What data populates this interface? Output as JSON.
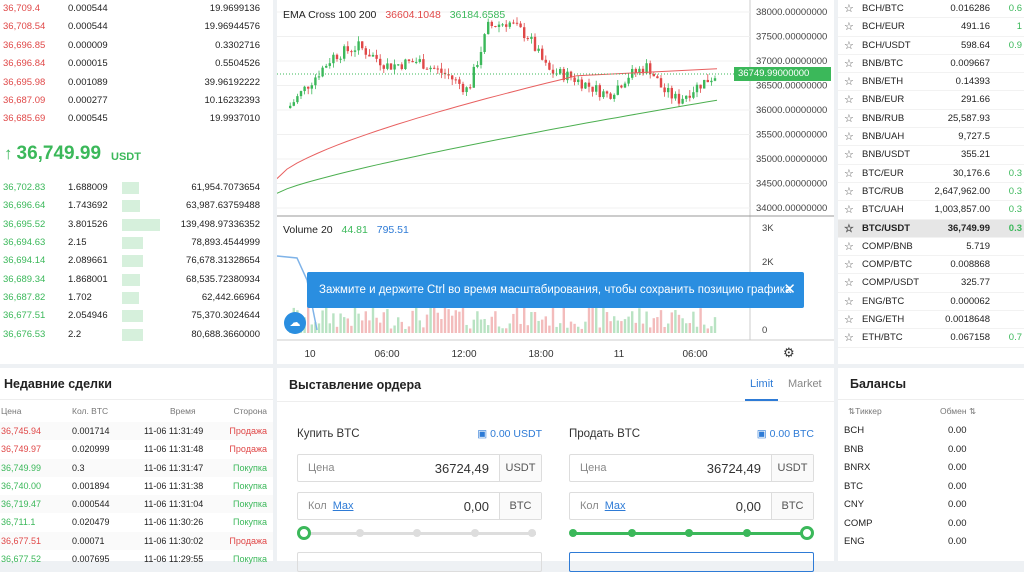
{
  "orderbook": {
    "asks": [
      {
        "p": "36,709.4",
        "a": "0.000544",
        "t": "19.9699136"
      },
      {
        "p": "36,708.54",
        "a": "0.000544",
        "t": "19.96944576"
      },
      {
        "p": "36,696.85",
        "a": "0.000009",
        "t": "0.3302716"
      },
      {
        "p": "36,696.84",
        "a": "0.000015",
        "t": "0.5504526"
      },
      {
        "p": "36,695.98",
        "a": "0.001089",
        "t": "39.96192222"
      },
      {
        "p": "36,687.09",
        "a": "0.000277",
        "t": "10.16232393"
      },
      {
        "p": "36,685.69",
        "a": "0.000545",
        "t": "19.9937010"
      }
    ],
    "last_price": "36,749.99",
    "last_unit": "USDT",
    "bids": [
      {
        "p": "36,702.83",
        "a": "1.688009",
        "t": "61,954.7073654",
        "f": 0.12
      },
      {
        "p": "36,696.64",
        "a": "1.743692",
        "t": "63,987.63759488",
        "f": 0.13
      },
      {
        "p": "36,695.52",
        "a": "3.801526",
        "t": "139,498.97336352",
        "f": 0.27
      },
      {
        "p": "36,694.63",
        "a": "2.15",
        "t": "78,893.4544999",
        "f": 0.15
      },
      {
        "p": "36,694.14",
        "a": "2.089661",
        "t": "76,678.31328654",
        "f": 0.15
      },
      {
        "p": "36,689.34",
        "a": "1.868001",
        "t": "68,535.72380934",
        "f": 0.13
      },
      {
        "p": "36,687.82",
        "a": "1.702",
        "t": "62,442.66964",
        "f": 0.12
      },
      {
        "p": "36,677.51",
        "a": "2.054946",
        "t": "75,370.3024644",
        "f": 0.15
      },
      {
        "p": "36,676.53",
        "a": "2.2",
        "t": "80,688.3660000",
        "f": 0.15
      }
    ]
  },
  "chart": {
    "ema_label": "EMA Cross 100 200",
    "ema1": "36604.1048",
    "ema2": "36184.6585",
    "volume_label": "Volume 20",
    "vol1": "44.81",
    "vol2": "795.51",
    "price_ticks": [
      "38000.00000000",
      "37500.00000000",
      "37000.00000000",
      "36500.00000000",
      "36000.00000000",
      "35500.00000000",
      "35000.00000000",
      "34500.00000000",
      "34000.00000000"
    ],
    "current_price": "36749.99000000",
    "vol_ticks": [
      "3K",
      "2K",
      "1K",
      "0"
    ],
    "time_ticks": [
      "10",
      "06:00",
      "12:00",
      "18:00",
      "11",
      "06:00"
    ],
    "colors": {
      "up": "#3bb85a",
      "down": "#e04848",
      "ema_fast": "#e86060",
      "ema_slow": "#4caf50"
    }
  },
  "tooltip": {
    "text": "Зажмите и держите Ctrl во время масштабирования, чтобы сохранить позицию графика",
    "close": "✕"
  },
  "pairs": [
    {
      "n": "BCH/BTC",
      "p": "0.016286",
      "c": "0.6"
    },
    {
      "n": "BCH/EUR",
      "p": "491.16",
      "c": "1"
    },
    {
      "n": "BCH/USDT",
      "p": "598.64",
      "c": "0.9"
    },
    {
      "n": "BNB/BTC",
      "p": "0.009667",
      "c": ""
    },
    {
      "n": "BNB/ETH",
      "p": "0.14393",
      "c": ""
    },
    {
      "n": "BNB/EUR",
      "p": "291.66",
      "c": ""
    },
    {
      "n": "BNB/RUB",
      "p": "25,587.93",
      "c": ""
    },
    {
      "n": "BNB/UAH",
      "p": "9,727.5",
      "c": ""
    },
    {
      "n": "BNB/USDT",
      "p": "355.21",
      "c": ""
    },
    {
      "n": "BTC/EUR",
      "p": "30,176.6",
      "c": "0.3"
    },
    {
      "n": "BTC/RUB",
      "p": "2,647,962.00",
      "c": "0.3"
    },
    {
      "n": "BTC/UAH",
      "p": "1,003,857.00",
      "c": "0.3"
    },
    {
      "n": "BTC/USDT",
      "p": "36,749.99",
      "c": "0.3",
      "sel": true
    },
    {
      "n": "COMP/BNB",
      "p": "5.719",
      "c": ""
    },
    {
      "n": "COMP/BTC",
      "p": "0.008868",
      "c": ""
    },
    {
      "n": "COMP/USDT",
      "p": "325.77",
      "c": ""
    },
    {
      "n": "ENG/BTC",
      "p": "0.000062",
      "c": ""
    },
    {
      "n": "ENG/ETH",
      "p": "0.0018648",
      "c": ""
    },
    {
      "n": "ETH/BTC",
      "p": "0.067158",
      "c": "0.7"
    }
  ],
  "trades": {
    "title": "Недавние сделки",
    "headers": [
      "Цена",
      "Кол. BTC",
      "Время",
      "Сторона"
    ],
    "rows": [
      {
        "p": "36,745.94",
        "a": "0.001714",
        "t": "11-06 11:31:49",
        "s": "Продажа",
        "side": "sell"
      },
      {
        "p": "36,749.97",
        "a": "0.020999",
        "t": "11-06 11:31:48",
        "s": "Продажа",
        "side": "sell"
      },
      {
        "p": "36,749.99",
        "a": "0.3",
        "t": "11-06 11:31:47",
        "s": "Покупка",
        "side": "buy"
      },
      {
        "p": "36,740.00",
        "a": "0.001894",
        "t": "11-06 11:31:38",
        "s": "Покупка",
        "side": "buy"
      },
      {
        "p": "36,719.47",
        "a": "0.000544",
        "t": "11-06 11:31:04",
        "s": "Покупка",
        "side": "buy"
      },
      {
        "p": "36,711.1",
        "a": "0.020479",
        "t": "11-06 11:30:26",
        "s": "Покупка",
        "side": "buy"
      },
      {
        "p": "36,677.51",
        "a": "0.00071",
        "t": "11-06 11:30:02",
        "s": "Продажа",
        "side": "sell"
      },
      {
        "p": "36,677.52",
        "a": "0.007695",
        "t": "11-06 11:29:55",
        "s": "Покупка",
        "side": "buy"
      }
    ]
  },
  "order": {
    "title": "Выставление ордера",
    "tab_limit": "Limit",
    "tab_market": "Market",
    "buy": {
      "label": "Купить BTC",
      "balance": "0.00 USDT",
      "price_ph": "Цена",
      "price": "36724,49",
      "price_cur": "USDT",
      "qty_ph": "Кол",
      "max": "Max",
      "qty": "0,00",
      "qty_cur": "BTC"
    },
    "sell": {
      "label": "Продать BTC",
      "balance": "0.00 BTC",
      "price_ph": "Цена",
      "price": "36724,49",
      "price_cur": "USDT",
      "qty_ph": "Кол",
      "max": "Max",
      "qty": "0,00",
      "qty_cur": "BTC"
    }
  },
  "balances": {
    "title": "Балансы",
    "h1": "Тиккер",
    "h2": "Обмен",
    "rows": [
      {
        "t": "BCH",
        "v": "0.00"
      },
      {
        "t": "BNB",
        "v": "0.00"
      },
      {
        "t": "BNRX",
        "v": "0.00"
      },
      {
        "t": "BTC",
        "v": "0.00"
      },
      {
        "t": "CNY",
        "v": "0.00"
      },
      {
        "t": "COMP",
        "v": "0.00"
      },
      {
        "t": "ENG",
        "v": "0.00"
      }
    ]
  }
}
